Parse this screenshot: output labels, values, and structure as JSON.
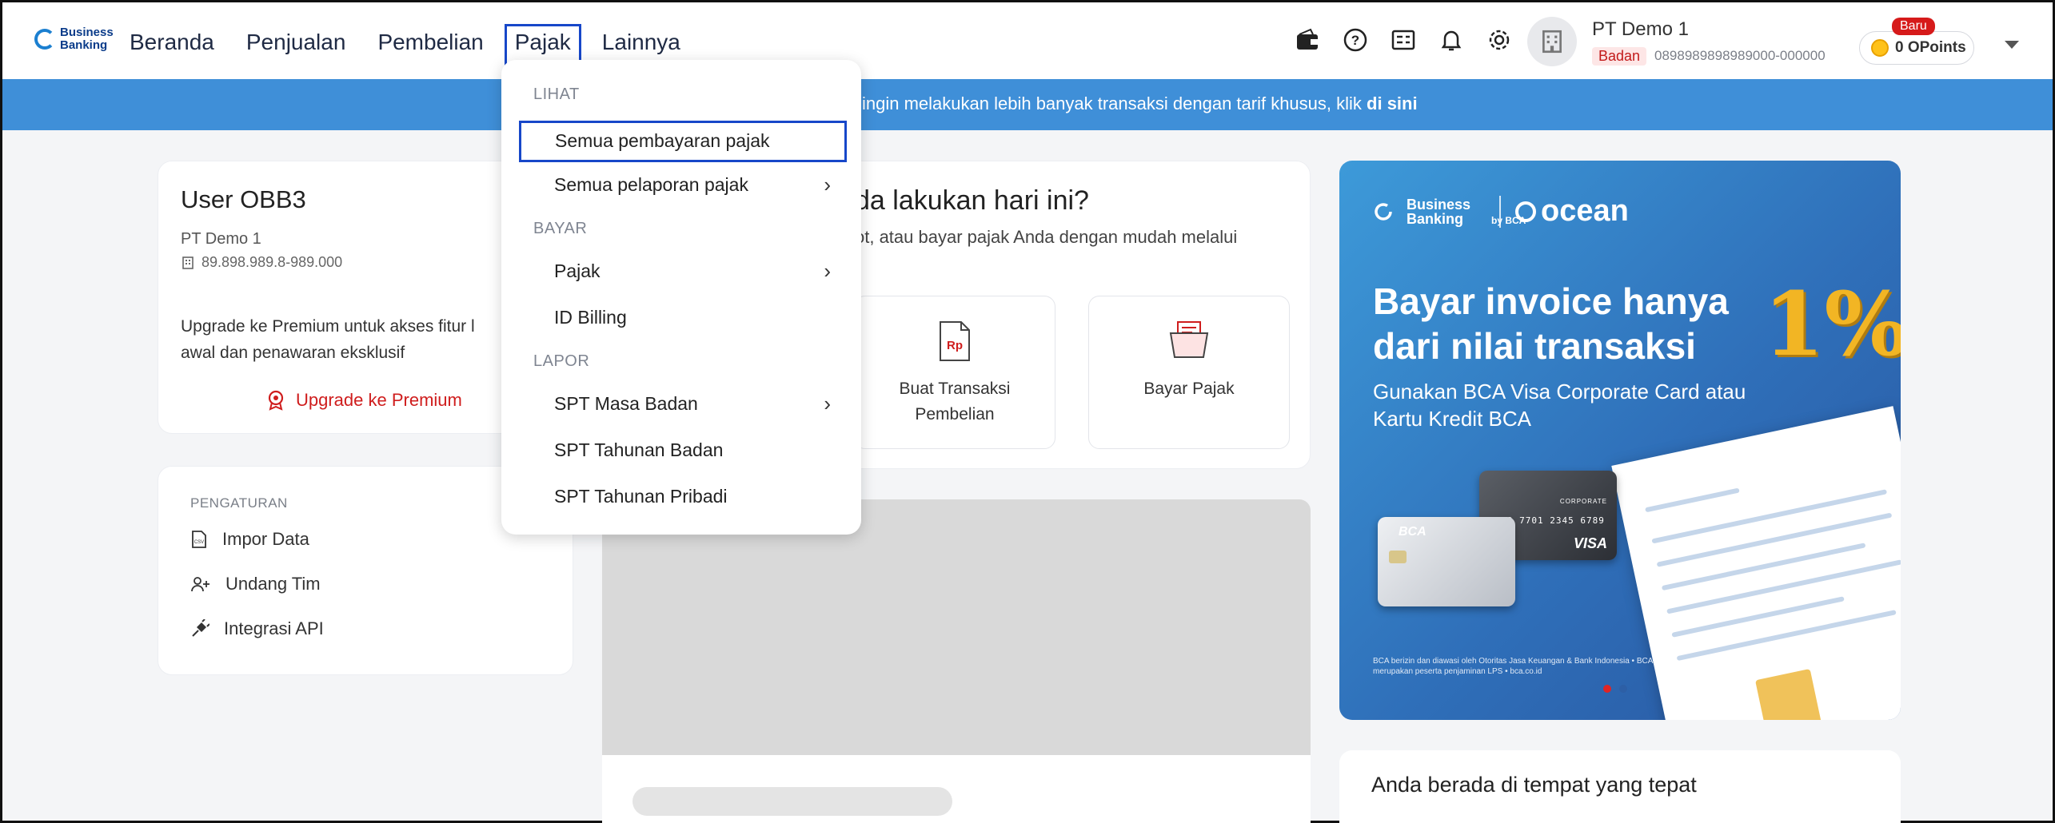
{
  "header": {
    "logo_text": "Business Banking",
    "nav": [
      "Beranda",
      "Penjualan",
      "Pembelian",
      "Pajak",
      "Lainnya"
    ],
    "selected_nav": "Pajak",
    "company_name": "PT Demo 1",
    "company_type": "Badan",
    "company_id": "0898989898989000-000000",
    "points_badge": "Baru",
    "points_label": "0 OPoints",
    "icons": [
      "wallet-icon",
      "help-icon",
      "report-icon",
      "bell-icon",
      "gear-icon",
      "building-icon"
    ]
  },
  "banner": {
    "text": "ingin melakukan lebih banyak transaksi dengan tarif khusus, klik ",
    "link": "di sini"
  },
  "user_card": {
    "name": "User OBB3",
    "company": "PT Demo 1",
    "npwp": "89.898.989.8-989.000",
    "upgrade_text": "Upgrade ke Premium untuk akses fitur l",
    "upgrade_text2": "awal dan penawaran eksklusif",
    "upgrade_link": "Upgrade ke Premium"
  },
  "settings": {
    "title": "PENGATURAN",
    "items": [
      "Impor Data",
      "Undang Tim",
      "Integrasi API"
    ]
  },
  "actions": {
    "title": "da lakukan hari ini?",
    "subtitle": "ot, atau bayar pajak Anda dengan mudah melalui",
    "tiles": [
      {
        "label_line1": "Buat Transaksi",
        "label_line2": "Pembelian",
        "icon": "rp-document-icon"
      },
      {
        "label_line1": "Bayar Pajak",
        "label_line2": "",
        "icon": "tax-folder-icon"
      }
    ]
  },
  "promo": {
    "bb_logo": "Business Banking",
    "ocean_logo": "ocean",
    "ocean_sub": "by BCA",
    "title_line1": "Bayar invoice hanya",
    "title_line2": "dari nilai transaksi",
    "percent": "1%",
    "subtitle": "Gunakan BCA Visa Corporate Card atau Kartu Kredit BCA",
    "footnote": "BCA berizin dan diawasi oleh Otoritas Jasa Keuangan & Bank Indonesia • BCA merupakan peserta penjaminan LPS • bca.co.id",
    "card_brand": "BCA",
    "card_visa": "VISA",
    "card_number": "4773 7701 2345 6789",
    "card_tier": "CORPORATE"
  },
  "welcome": {
    "title": "Anda berada di tempat yang tepat"
  },
  "dropdown": {
    "sections": [
      {
        "title": "LIHAT",
        "items": [
          {
            "label": "Semua pembayaran pajak",
            "chevron": false
          },
          {
            "label": "Semua pelaporan pajak",
            "chevron": true
          }
        ]
      },
      {
        "title": "BAYAR",
        "items": [
          {
            "label": "Pajak",
            "chevron": true
          },
          {
            "label": "ID Billing",
            "chevron": false
          }
        ]
      },
      {
        "title": "LAPOR",
        "items": [
          {
            "label": "SPT Masa Badan",
            "chevron": true
          },
          {
            "label": "SPT Tahunan Badan",
            "chevron": false
          },
          {
            "label": "SPT Tahunan Pribadi",
            "chevron": false
          }
        ]
      }
    ],
    "highlighted": "Semua pembayaran pajak",
    "chevron_glyph": "›"
  },
  "colors": {
    "accent_blue": "#1747c9",
    "banner": "#3f8fd8",
    "premium_red": "#cf1d1d"
  }
}
